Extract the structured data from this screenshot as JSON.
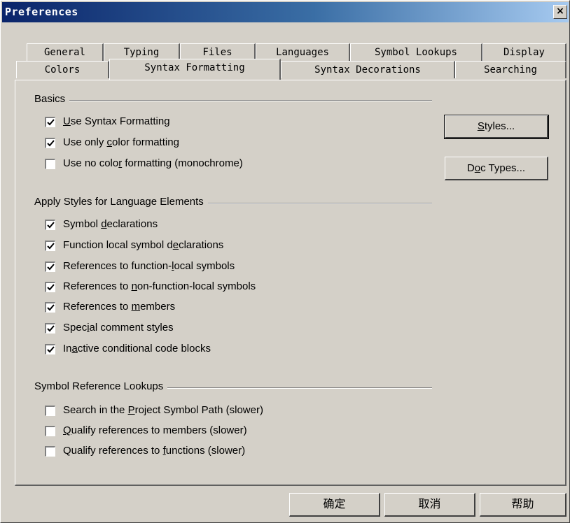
{
  "window": {
    "title": "Preferences",
    "close_glyph": "×"
  },
  "tabs_row1": [
    {
      "label": "General"
    },
    {
      "label": "Typing"
    },
    {
      "label": "Files"
    },
    {
      "label": "Languages"
    },
    {
      "label": "Symbol Lookups"
    },
    {
      "label": "Display"
    }
  ],
  "tabs_row2": [
    {
      "label": "Colors"
    },
    {
      "label": "Syntax Formatting",
      "active": true
    },
    {
      "label": "Syntax Decorations"
    },
    {
      "label": "Searching"
    }
  ],
  "groups": {
    "basics": {
      "label": "Basics",
      "items": [
        {
          "pre": "",
          "key": "U",
          "post": "se Syntax Formatting",
          "checked": true
        },
        {
          "pre": "Use only ",
          "key": "c",
          "post": "olor formatting",
          "checked": true
        },
        {
          "pre": "Use no colo",
          "key": "r",
          "post": " formatting (monochrome)",
          "checked": false
        }
      ]
    },
    "apply_styles": {
      "label": "Apply Styles for Language Elements",
      "items": [
        {
          "pre": "Symbol ",
          "key": "d",
          "post": "eclarations",
          "checked": true
        },
        {
          "pre": "Function local symbol d",
          "key": "e",
          "post": "clarations",
          "checked": true
        },
        {
          "pre": "References to function-",
          "key": "l",
          "post": "ocal symbols",
          "checked": true
        },
        {
          "pre": "References to ",
          "key": "n",
          "post": "on-function-local symbols",
          "checked": true
        },
        {
          "pre": "References to ",
          "key": "m",
          "post": "embers",
          "checked": true
        },
        {
          "pre": "Spec",
          "key": "i",
          "post": "al comment styles",
          "checked": true
        },
        {
          "pre": "In",
          "key": "a",
          "post": "ctive conditional code blocks",
          "checked": true
        }
      ]
    },
    "symbol_lookups": {
      "label": "Symbol Reference Lookups",
      "items": [
        {
          "pre": "Search in the ",
          "key": "P",
          "post": "roject Symbol Path (slower)",
          "checked": false
        },
        {
          "pre": "",
          "key": "Q",
          "post": "ualify references to members (slower)",
          "checked": false
        },
        {
          "pre": "Qualify references to ",
          "key": "f",
          "post": "unctions (slower)",
          "checked": false
        }
      ]
    }
  },
  "side_buttons": {
    "styles": {
      "pre": "",
      "key": "S",
      "post": "tyles..."
    },
    "doc_types": {
      "pre": "D",
      "key": "o",
      "post": "c Types..."
    }
  },
  "footer": {
    "ok": "确定",
    "cancel": "取消",
    "help": "帮助"
  },
  "icons": {
    "checkmark": "check-icon",
    "close": "close-icon"
  },
  "colors": {
    "title_start": "#0a246a",
    "title_end": "#a6caf0",
    "face": "#d4d0c8"
  }
}
